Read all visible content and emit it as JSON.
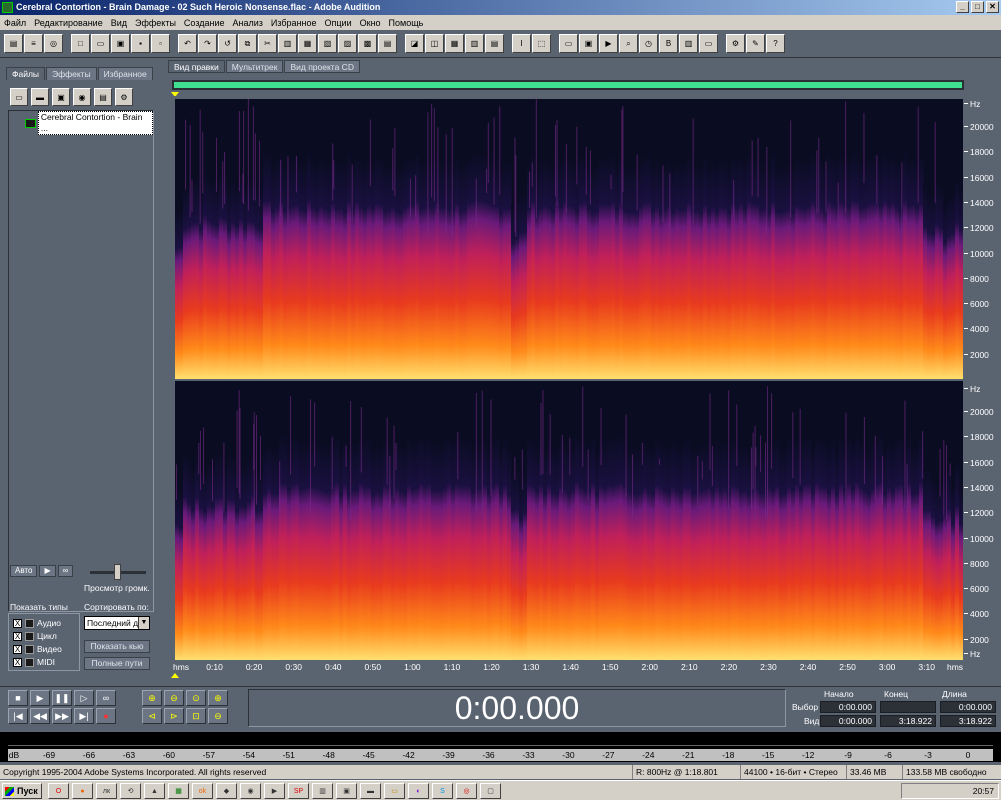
{
  "window": {
    "title": "Cerebral Contortion - Brain Damage - 02 Such Heroic Nonsense.flac - Adobe Audition",
    "controls": [
      "_",
      "□",
      "✕"
    ]
  },
  "menu": [
    "Файл",
    "Редактирование",
    "Вид",
    "Эффекты",
    "Создание",
    "Анализ",
    "Избранное",
    "Опции",
    "Окно",
    "Помощь"
  ],
  "left_panel": {
    "tabs": [
      "Файлы",
      "Эффекты",
      "Избранное"
    ],
    "active_tab": "Файлы",
    "file_item": "Cerebral Contortion - Brain ...",
    "auto_label": "Авто",
    "preview_volume_label": "Просмотр громк.",
    "show_types_label": "Показать типы",
    "sort_label": "Сортировать по:",
    "types": [
      {
        "label": "Аудио",
        "checked": "X"
      },
      {
        "label": "Цикл",
        "checked": "X"
      },
      {
        "label": "Видео",
        "checked": "X"
      },
      {
        "label": "MIDI",
        "checked": "X"
      }
    ],
    "sort_value": "Последний до",
    "show_cue_button": "Показать кью",
    "full_paths_button": "Полные пути"
  },
  "main_tabs": [
    "Вид правки",
    "Мультитрек",
    "Вид проекта CD"
  ],
  "active_main_tab": "Вид правки",
  "hz_unit": "Hz",
  "hz_ticks": [
    "20000",
    "18000",
    "16000",
    "14000",
    "12000",
    "10000",
    "8000",
    "6000",
    "4000",
    "2000"
  ],
  "time_axis": {
    "unit": "hms",
    "labels": [
      "0:10",
      "0:20",
      "0:30",
      "0:40",
      "0:50",
      "1:00",
      "1:10",
      "1:20",
      "1:30",
      "1:40",
      "1:50",
      "2:00",
      "2:10",
      "2:20",
      "2:30",
      "2:40",
      "2:50",
      "3:00",
      "3:10"
    ]
  },
  "time_display": "0:00.000",
  "selection": {
    "headers": [
      "Начало",
      "Конец",
      "Длина"
    ],
    "rows": [
      {
        "label": "Выбор",
        "start": "0:00.000",
        "end": "",
        "length": "0:00.000"
      },
      {
        "label": "Вид",
        "start": "0:00.000",
        "end": "3:18.922",
        "length": "3:18.922"
      }
    ]
  },
  "level_meter": {
    "unit": "dB",
    "labels": [
      "-69",
      "-66",
      "-63",
      "-60",
      "-57",
      "-54",
      "-51",
      "-48",
      "-45",
      "-42",
      "-39",
      "-36",
      "-33",
      "-30",
      "-27",
      "-24",
      "-21",
      "-18",
      "-15",
      "-12",
      "-9",
      "-6",
      "-3",
      "0"
    ]
  },
  "status_bar": {
    "copyright": "Copyright 1995-2004 Adobe Systems Incorporated. All rights reserved",
    "cursor": "R: 800Hz @   1:18.801",
    "format": "44100 • 16-бит • Стерео",
    "size": "33.46 MB",
    "free": "133.58 MB свободно"
  },
  "taskbar": {
    "start": "Пуск",
    "clock": "20:57"
  },
  "colors": {
    "panel_bg": "#5a6370",
    "spectrogram_bg": "#0a0c22",
    "selection_range": "#3fe08f",
    "marker": "#ffff00"
  }
}
